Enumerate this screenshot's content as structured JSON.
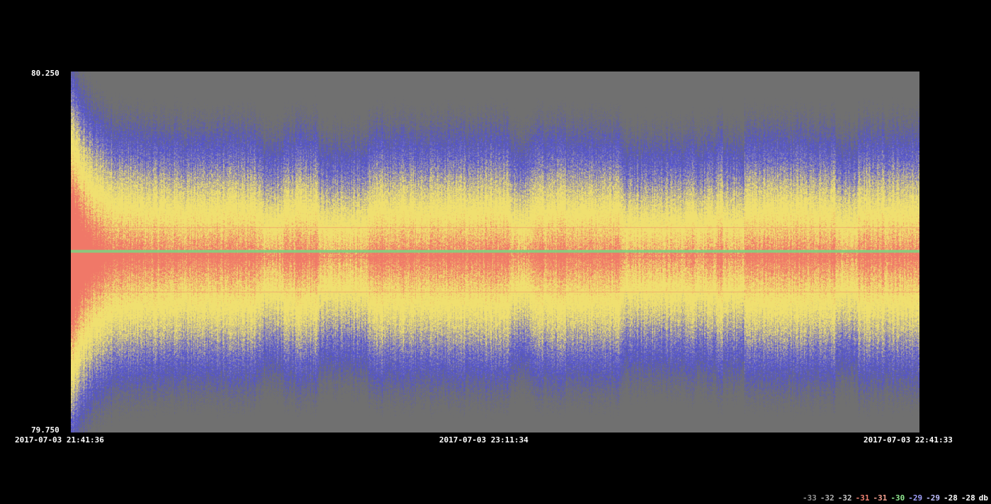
{
  "chart_data": {
    "type": "heatmap",
    "title": "",
    "y_axis": {
      "top_label": "80.250",
      "bottom_label": "79.750",
      "range": [
        79.75,
        80.25
      ]
    },
    "x_axis": {
      "labels": [
        "2017-07-03 21:41:36",
        "2017-07-03 23:11:34",
        "2017-07-03 22:41:33"
      ]
    },
    "scale": {
      "labels": [
        "-33",
        "-32",
        "-32",
        "-31",
        "-31",
        "-30",
        "-29",
        "-29",
        "-28",
        "-28"
      ],
      "unit": "db",
      "colors": [
        "#909090",
        "#b0b0b0",
        "#c8c8c8",
        "#f08070",
        "#f4a090",
        "#90e890",
        "#a0a0ff",
        "#c0c0ff",
        "#ffffff",
        "#ffffff"
      ]
    },
    "palette": {
      "low": "#707070",
      "mid_low": "#5050d8",
      "mid_high": "#f0e070",
      "high": "#f07868",
      "line": "#80d080"
    },
    "features": {
      "narrowband_carrier": "green horizontal line just above center",
      "strong_signal_start": "red/orange near left edge"
    }
  }
}
